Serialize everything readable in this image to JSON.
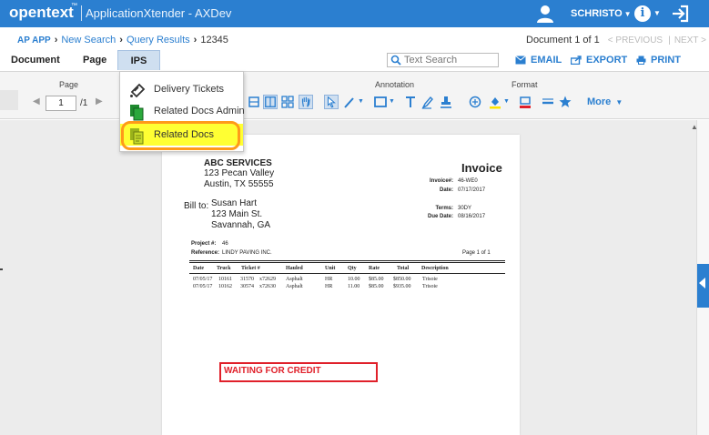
{
  "header": {
    "brand": "opentext",
    "brand_mark": "™",
    "app_title": "ApplicationXtender - AXDev",
    "user_name": "SCHRISTO",
    "icons": [
      "user-icon",
      "info-icon",
      "logout-icon"
    ]
  },
  "breadcrumb": {
    "app": "AP APP",
    "items": [
      "New Search",
      "Query Results"
    ],
    "current": "12345"
  },
  "doc_nav": {
    "position": "Document 1 of 1",
    "prev": "< PREVIOUS",
    "next": "NEXT >"
  },
  "tabs": {
    "document": "Document",
    "page": "Page",
    "ips": "IPS"
  },
  "search": {
    "placeholder": "Text Search"
  },
  "actions": {
    "email": "EMAIL",
    "export": "EXPORT",
    "print": "PRINT"
  },
  "toolbar": {
    "page_label": "Page",
    "page_value": "1",
    "page_total": "/1",
    "annotation_label": "Annotation",
    "format_label": "Format",
    "more_label": "More"
  },
  "ips_menu": {
    "items": [
      {
        "label": "Delivery Tickets",
        "icon": "ticket-icon"
      },
      {
        "label": "Related Docs Admin",
        "icon": "docs-admin-icon"
      },
      {
        "label": "Related Docs",
        "icon": "related-docs-icon",
        "highlighted": true
      }
    ]
  },
  "invoice": {
    "company": "ABC SERVICES",
    "address": [
      "123 Pecan Valley",
      "Austin, TX 55555"
    ],
    "title": "Invoice",
    "fields": [
      {
        "key": "Invoice#:",
        "value": "46-WE0"
      },
      {
        "key": "Date:",
        "value": "07/17/2017"
      },
      {
        "key": "Terms:",
        "value": "30DY"
      },
      {
        "key": "Due Date:",
        "value": "08/16/2017"
      }
    ],
    "bill_to_label": "Bill to:",
    "bill_to": [
      "Susan Hart",
      "123 Main St.",
      "Savannah, GA"
    ],
    "project_label": "Project #:",
    "project": "46",
    "reference_label": "Reference:",
    "reference": "LINDY PAVING INC.",
    "page_of": "Page 1 of 1",
    "columns": [
      "Date",
      "Truck",
      "Ticket #",
      "Hauled",
      "Unit",
      "Qty",
      "Rate",
      "Total",
      "Description"
    ],
    "rows": [
      [
        "07/05/17",
        "10161",
        "31570",
        "x72629",
        "Asphalt",
        "HR",
        "10.00",
        "$85.00",
        "$850.00",
        "Trisoie"
      ],
      [
        "07/05/17",
        "10162",
        "30574",
        "x72630",
        "Asphalt",
        "HR",
        "11.00",
        "$85.00",
        "$935.00",
        "Trisoie"
      ]
    ],
    "stamp": "WAITING FOR CREDIT"
  },
  "colors": {
    "header_blue": "#2b7fd0",
    "menu_highlight": "#ffff33",
    "highlight_ring": "#ff9a1a",
    "stamp_red": "#e0202a"
  }
}
